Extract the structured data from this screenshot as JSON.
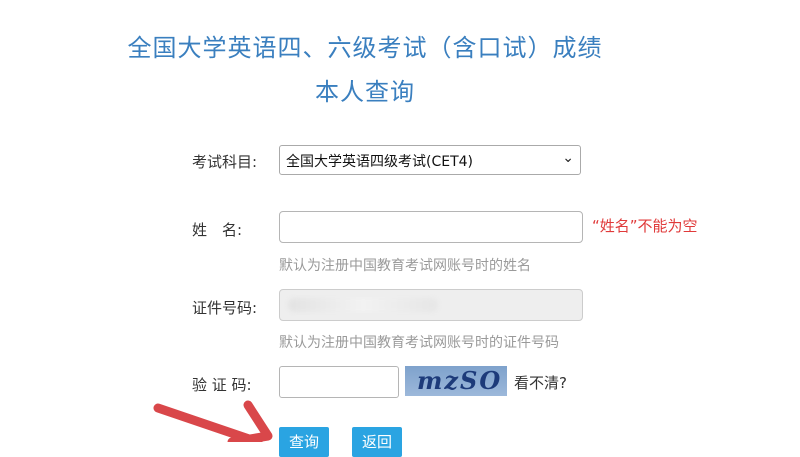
{
  "header": {
    "title_line1": "全国大学英语四、六级考试（含口试）成绩",
    "title_line2": "本人查询"
  },
  "form": {
    "subject": {
      "label": "考试科目:",
      "selected": "全国大学英语四级考试(CET4)"
    },
    "name": {
      "label": "姓　名:",
      "value": "",
      "error": "“姓名”不能为空",
      "hint": "默认为注册中国教育考试网账号时的姓名"
    },
    "id_number": {
      "label": "证件号码:",
      "hint": "默认为注册中国教育考试网账号时的证件号码"
    },
    "captcha": {
      "label": "验 证 码:",
      "image_text": "mzSO",
      "refresh_label": "看不清?"
    }
  },
  "buttons": {
    "query": "查询",
    "back": "返回"
  },
  "colors": {
    "title": "#3a7fbf",
    "error": "#e03a3a",
    "button": "#2aa4e2",
    "annotation_arrow": "#d9474a"
  }
}
